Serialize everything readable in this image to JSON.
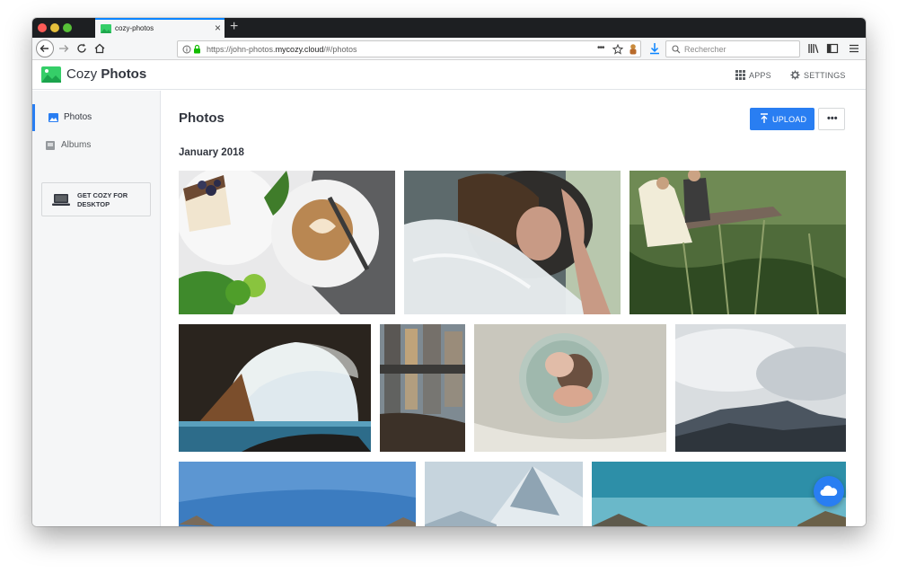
{
  "browser": {
    "tab_title": "cozy-photos",
    "new_tab_label": "+",
    "url_prefix": "https://john-photos.",
    "url_domain": "mycozy.cloud",
    "url_suffix": "/#/photos",
    "search_placeholder": "Rechercher"
  },
  "app": {
    "brand_light": "Cozy",
    "brand_strong": "Photos",
    "header_buttons": {
      "apps": "APPS",
      "settings": "SETTINGS"
    },
    "accent_color": "#297ef2"
  },
  "sidebar": {
    "items": [
      {
        "label": "Photos",
        "icon": "image-icon",
        "active": true
      },
      {
        "label": "Albums",
        "icon": "album-icon",
        "active": false
      }
    ],
    "desktop_promo": "GET COZY FOR DESKTOP"
  },
  "main": {
    "title": "Photos",
    "upload_label": "UPLOAD",
    "more_label": "•••",
    "section_title": "January 2018",
    "photos": [
      {
        "subject": "coffee-and-cake"
      },
      {
        "subject": "wedding-veil"
      },
      {
        "subject": "couple-on-bridge"
      },
      {
        "subject": "sea-cave"
      },
      {
        "subject": "city-reflection"
      },
      {
        "subject": "baby-on-blanket"
      },
      {
        "subject": "cloudy-mountains"
      },
      {
        "subject": "blue-sky-landscape"
      },
      {
        "subject": "snowy-peak"
      },
      {
        "subject": "turquoise-sky"
      }
    ]
  }
}
